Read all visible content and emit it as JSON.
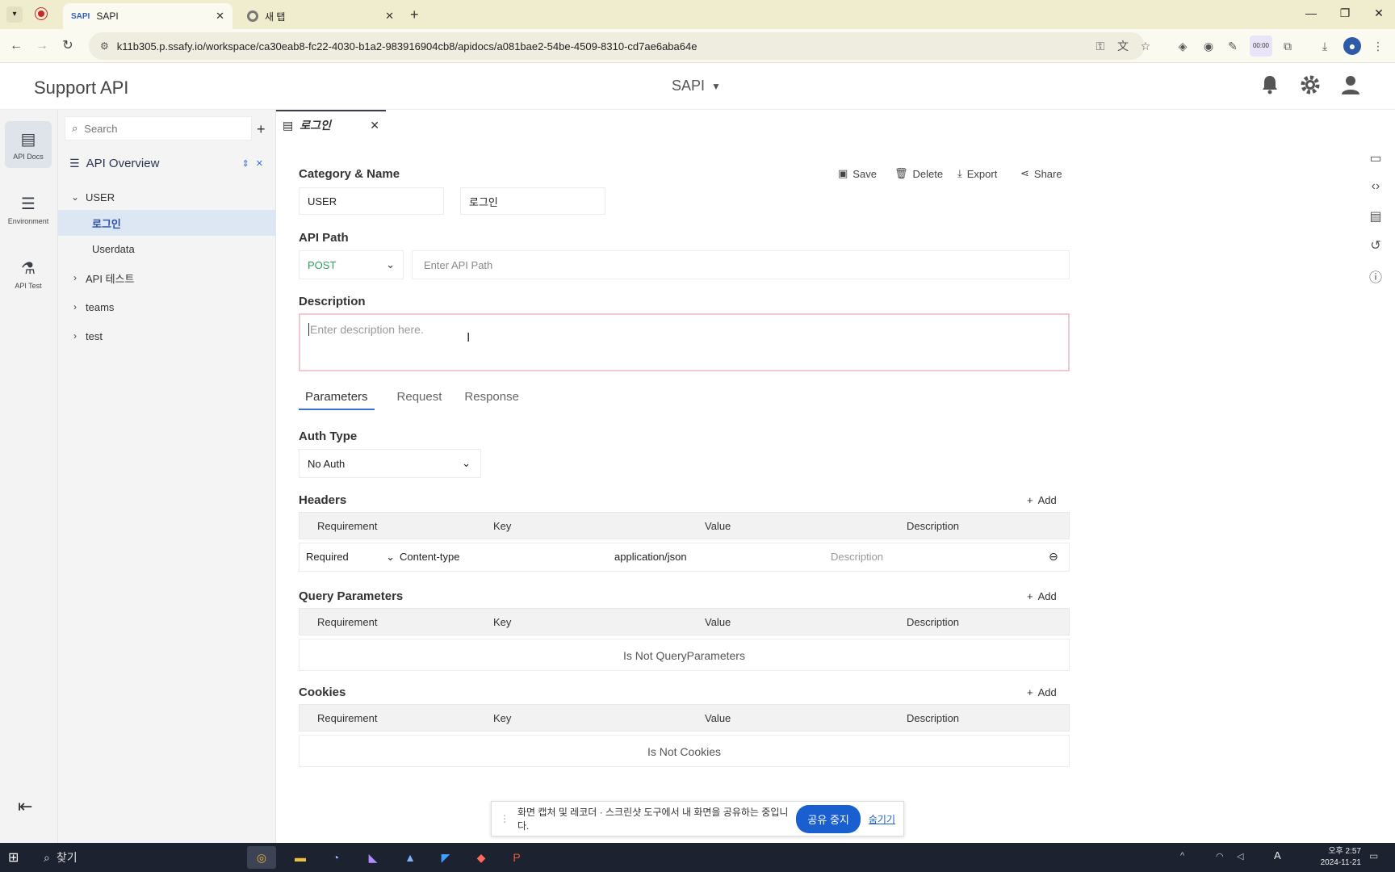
{
  "browser": {
    "tabs": [
      {
        "favicon": "SAPI",
        "title": "SAPI",
        "active": true
      },
      {
        "favicon": "chrome-icon",
        "title": "새 탭",
        "active": false
      }
    ],
    "url": "k11b305.p.ssafy.io/workspace/ca30eab8-fc22-4030-b1a2-983916904cb8/apidocs/a081bae2-54be-4509-8310-cd7ae6aba64e",
    "recording_badge": "00:00"
  },
  "header": {
    "title": "Support API",
    "workspace": "SAPI"
  },
  "rail": [
    {
      "label": "API Docs",
      "icon": "book-icon",
      "active": true
    },
    {
      "label": "Environment",
      "icon": "list-icon",
      "active": false
    },
    {
      "label": "API Test",
      "icon": "flask-icon",
      "active": false
    }
  ],
  "sidebar": {
    "search_placeholder": "Search",
    "overview": "API Overview",
    "tree": [
      {
        "label": "USER",
        "level": 0,
        "expanded": true
      },
      {
        "label": "로그인",
        "level": 1,
        "selected": true
      },
      {
        "label": "Userdata",
        "level": 1
      },
      {
        "label": "API 테스트",
        "level": 0,
        "expanded": false
      },
      {
        "label": "teams",
        "level": 0,
        "expanded": false
      },
      {
        "label": "test",
        "level": 0,
        "expanded": false
      }
    ]
  },
  "editor_tab": {
    "title": "로그인"
  },
  "main": {
    "category_name_label": "Category & Name",
    "category": "USER",
    "name": "로그인",
    "actions": {
      "save": "Save",
      "delete": "Delete",
      "export": "Export",
      "share": "Share"
    },
    "api_path_label": "API Path",
    "method": "POST",
    "path_placeholder": "Enter API Path",
    "description_label": "Description",
    "description_placeholder": "Enter description here.",
    "tabs": [
      "Parameters",
      "Request",
      "Response"
    ],
    "auth_type_label": "Auth Type",
    "auth_type": "No Auth",
    "columns": [
      "Requirement",
      "Key",
      "Value",
      "Description"
    ],
    "add_label": "Add",
    "headers": {
      "label": "Headers",
      "row": {
        "requirement": "Required",
        "key": "Content-type",
        "value": "application/json",
        "description_placeholder": "Description"
      }
    },
    "query": {
      "label": "Query Parameters",
      "empty": "Is Not QueryParameters"
    },
    "cookies": {
      "label": "Cookies",
      "empty": "Is Not Cookies"
    }
  },
  "share_banner": {
    "text": "화면 캡처 및 레코더 · 스크린샷 도구에서 내 화면을 공유하는 중입니다.",
    "stop": "공유 중지",
    "hide": "숨기기"
  },
  "taskbar": {
    "search": "찾기",
    "time": "오후 2:57",
    "date": "2024-11-21"
  },
  "colors": {
    "accent": "#3a6fd8",
    "post": "#2e9e5b",
    "desc_border": "#f2c7cf"
  }
}
